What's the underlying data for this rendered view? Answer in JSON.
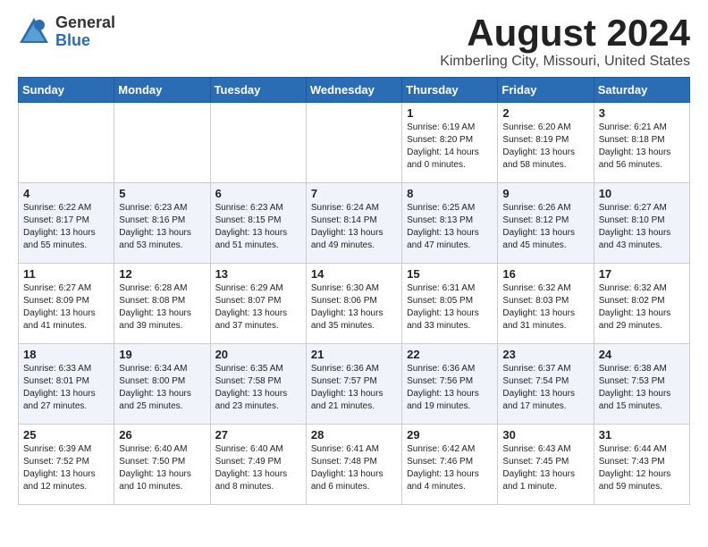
{
  "header": {
    "logo_general": "General",
    "logo_blue": "Blue",
    "title": "August 2024",
    "location": "Kimberling City, Missouri, United States"
  },
  "weekdays": [
    "Sunday",
    "Monday",
    "Tuesday",
    "Wednesday",
    "Thursday",
    "Friday",
    "Saturday"
  ],
  "weeks": [
    [
      {
        "day": "",
        "info": ""
      },
      {
        "day": "",
        "info": ""
      },
      {
        "day": "",
        "info": ""
      },
      {
        "day": "",
        "info": ""
      },
      {
        "day": "1",
        "info": "Sunrise: 6:19 AM\nSunset: 8:20 PM\nDaylight: 14 hours\nand 0 minutes."
      },
      {
        "day": "2",
        "info": "Sunrise: 6:20 AM\nSunset: 8:19 PM\nDaylight: 13 hours\nand 58 minutes."
      },
      {
        "day": "3",
        "info": "Sunrise: 6:21 AM\nSunset: 8:18 PM\nDaylight: 13 hours\nand 56 minutes."
      }
    ],
    [
      {
        "day": "4",
        "info": "Sunrise: 6:22 AM\nSunset: 8:17 PM\nDaylight: 13 hours\nand 55 minutes."
      },
      {
        "day": "5",
        "info": "Sunrise: 6:23 AM\nSunset: 8:16 PM\nDaylight: 13 hours\nand 53 minutes."
      },
      {
        "day": "6",
        "info": "Sunrise: 6:23 AM\nSunset: 8:15 PM\nDaylight: 13 hours\nand 51 minutes."
      },
      {
        "day": "7",
        "info": "Sunrise: 6:24 AM\nSunset: 8:14 PM\nDaylight: 13 hours\nand 49 minutes."
      },
      {
        "day": "8",
        "info": "Sunrise: 6:25 AM\nSunset: 8:13 PM\nDaylight: 13 hours\nand 47 minutes."
      },
      {
        "day": "9",
        "info": "Sunrise: 6:26 AM\nSunset: 8:12 PM\nDaylight: 13 hours\nand 45 minutes."
      },
      {
        "day": "10",
        "info": "Sunrise: 6:27 AM\nSunset: 8:10 PM\nDaylight: 13 hours\nand 43 minutes."
      }
    ],
    [
      {
        "day": "11",
        "info": "Sunrise: 6:27 AM\nSunset: 8:09 PM\nDaylight: 13 hours\nand 41 minutes."
      },
      {
        "day": "12",
        "info": "Sunrise: 6:28 AM\nSunset: 8:08 PM\nDaylight: 13 hours\nand 39 minutes."
      },
      {
        "day": "13",
        "info": "Sunrise: 6:29 AM\nSunset: 8:07 PM\nDaylight: 13 hours\nand 37 minutes."
      },
      {
        "day": "14",
        "info": "Sunrise: 6:30 AM\nSunset: 8:06 PM\nDaylight: 13 hours\nand 35 minutes."
      },
      {
        "day": "15",
        "info": "Sunrise: 6:31 AM\nSunset: 8:05 PM\nDaylight: 13 hours\nand 33 minutes."
      },
      {
        "day": "16",
        "info": "Sunrise: 6:32 AM\nSunset: 8:03 PM\nDaylight: 13 hours\nand 31 minutes."
      },
      {
        "day": "17",
        "info": "Sunrise: 6:32 AM\nSunset: 8:02 PM\nDaylight: 13 hours\nand 29 minutes."
      }
    ],
    [
      {
        "day": "18",
        "info": "Sunrise: 6:33 AM\nSunset: 8:01 PM\nDaylight: 13 hours\nand 27 minutes."
      },
      {
        "day": "19",
        "info": "Sunrise: 6:34 AM\nSunset: 8:00 PM\nDaylight: 13 hours\nand 25 minutes."
      },
      {
        "day": "20",
        "info": "Sunrise: 6:35 AM\nSunset: 7:58 PM\nDaylight: 13 hours\nand 23 minutes."
      },
      {
        "day": "21",
        "info": "Sunrise: 6:36 AM\nSunset: 7:57 PM\nDaylight: 13 hours\nand 21 minutes."
      },
      {
        "day": "22",
        "info": "Sunrise: 6:36 AM\nSunset: 7:56 PM\nDaylight: 13 hours\nand 19 minutes."
      },
      {
        "day": "23",
        "info": "Sunrise: 6:37 AM\nSunset: 7:54 PM\nDaylight: 13 hours\nand 17 minutes."
      },
      {
        "day": "24",
        "info": "Sunrise: 6:38 AM\nSunset: 7:53 PM\nDaylight: 13 hours\nand 15 minutes."
      }
    ],
    [
      {
        "day": "25",
        "info": "Sunrise: 6:39 AM\nSunset: 7:52 PM\nDaylight: 13 hours\nand 12 minutes."
      },
      {
        "day": "26",
        "info": "Sunrise: 6:40 AM\nSunset: 7:50 PM\nDaylight: 13 hours\nand 10 minutes."
      },
      {
        "day": "27",
        "info": "Sunrise: 6:40 AM\nSunset: 7:49 PM\nDaylight: 13 hours\nand 8 minutes."
      },
      {
        "day": "28",
        "info": "Sunrise: 6:41 AM\nSunset: 7:48 PM\nDaylight: 13 hours\nand 6 minutes."
      },
      {
        "day": "29",
        "info": "Sunrise: 6:42 AM\nSunset: 7:46 PM\nDaylight: 13 hours\nand 4 minutes."
      },
      {
        "day": "30",
        "info": "Sunrise: 6:43 AM\nSunset: 7:45 PM\nDaylight: 13 hours\nand 1 minute."
      },
      {
        "day": "31",
        "info": "Sunrise: 6:44 AM\nSunset: 7:43 PM\nDaylight: 12 hours\nand 59 minutes."
      }
    ]
  ]
}
